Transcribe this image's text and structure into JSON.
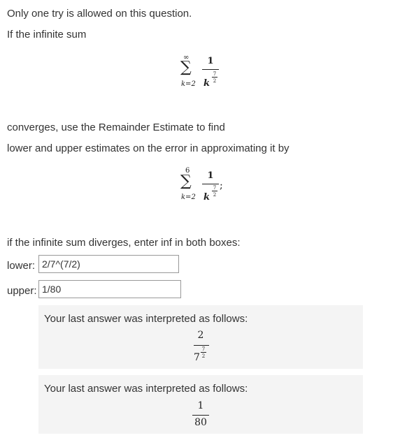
{
  "intro": {
    "one_try": "Only one try is allowed on this question.",
    "if_infinite": "If the infinite sum"
  },
  "sum1": {
    "upper": "∞",
    "lower": "k=2",
    "numerator": "1",
    "base": "k",
    "exp_num": "7",
    "exp_den": "2"
  },
  "middle": {
    "converges": "converges, use the Remainder Estimate to find",
    "lower_upper": "lower and upper estimates on the error in approximating it by"
  },
  "sum2": {
    "upper": "6",
    "lower": "k=2",
    "numerator": "1",
    "base": "k",
    "exp_num": "7",
    "exp_den": "2",
    "trailing": ";"
  },
  "diverges": "if the infinite sum diverges, enter inf in both boxes:",
  "fields": {
    "lower_label": "lower:",
    "lower_value": "2/7^(7/2)",
    "upper_label": "upper:",
    "upper_value": "1/80"
  },
  "interpretations": [
    {
      "text": "Your last answer was interpreted as follows:",
      "numerator": "2",
      "base": "7",
      "exp_num": "7",
      "exp_den": "2"
    },
    {
      "text": "Your last answer was interpreted as follows:",
      "numerator": "1",
      "denominator": "80"
    }
  ]
}
